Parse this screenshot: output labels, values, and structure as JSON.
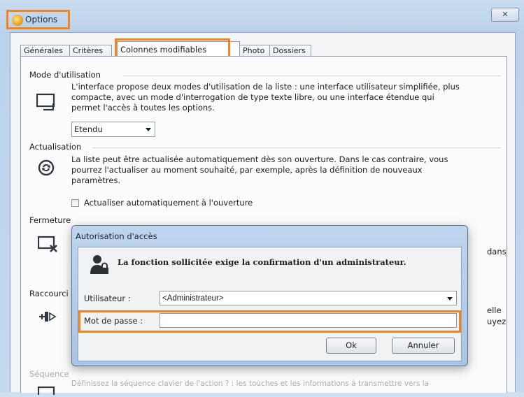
{
  "window": {
    "title": "Options",
    "close_label": "✕"
  },
  "tabs": [
    {
      "label": "Générales",
      "active": false
    },
    {
      "label": "Critères",
      "active": false
    },
    {
      "label": "Colonnes modifiables",
      "active": true
    },
    {
      "label": "Photo",
      "active": false
    },
    {
      "label": "Dossiers",
      "active": false
    }
  ],
  "sections": {
    "mode": {
      "title": "Mode d'utilisation",
      "lines": [
        "L'interface propose deux modes d'utilisation de la liste : une interface utilisateur simplifiée, plus",
        "compacte, avec un mode d'interrogation de type texte libre, ou une interface étendue qui",
        "permet l'accès à toutes les options."
      ],
      "select_value": "Etendu"
    },
    "actualisation": {
      "title": "Actualisation",
      "lines": [
        "La liste peut être actualisée automatiquement dès son ouverture. Dans le cas contraire, vous",
        "pourrez l'actualiser au moment souhaité, par exemple, après la définition de nouveaux",
        "paramètres."
      ],
      "checkbox_label": "Actualiser automatiquement à l'ouverture",
      "checkbox_checked": false
    },
    "fermeture": {
      "title": "Fermeture",
      "peek": "dans"
    },
    "raccourcis": {
      "title": "Raccourci",
      "peek_1": "elle",
      "peek_2": "uyez"
    },
    "sequence": {
      "title": "Séquence",
      "line": "Définissez la séquence clavier de l'action ? : les touches et les informations à transmettre vers la"
    }
  },
  "dialog": {
    "title": "Autorisation d'accès",
    "message": "La fonction sollicitée exige la confirmation d'un administrateur.",
    "user_label": "Utilisateur :",
    "user_value": "<Administrateur>",
    "password_label": "Mot de passe :",
    "password_value": "",
    "ok_label": "Ok",
    "cancel_label": "Annuler"
  },
  "colors": {
    "highlight": "#f2831e"
  }
}
